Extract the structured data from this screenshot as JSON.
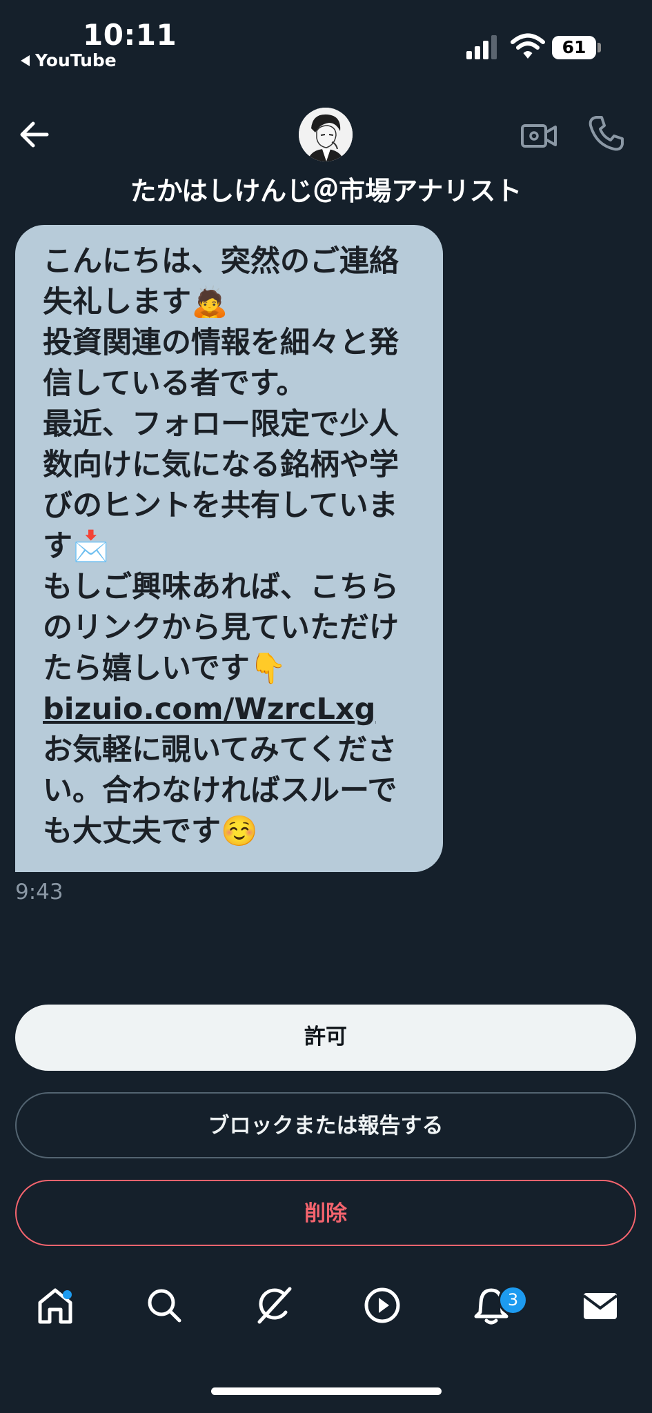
{
  "status_bar": {
    "time": "10:11",
    "back_app": "YouTube",
    "battery": "61"
  },
  "header": {
    "contact_name": "たかはしけんじ＠市場アナリスト",
    "back_icon": "arrow-left-icon",
    "video_icon": "video-camera-icon",
    "phone_icon": "phone-icon"
  },
  "message": {
    "text_before_link": "こんにちは、突然のご連絡失礼します🙇\n投資関連の情報を細々と発信している者です。\n最近、フォロー限定で少人数向けに気になる銘柄や学びのヒントを共有しています📩\nもしご興味あれば、こちらのリンクから見ていただけたら嬉しいです👇\n",
    "link": "bizuio.com/WzrcLxg",
    "text_after_link": "\nお気軽に覗いてみてください。合わなければスルーでも大丈夫です☺️",
    "time": "9:43"
  },
  "actions": {
    "allow": "許可",
    "block_report": "ブロックまたは報告する",
    "delete": "削除"
  },
  "tabbar": {
    "items": [
      "home-icon",
      "search-icon",
      "grok-icon",
      "play-icon",
      "bell-icon",
      "mail-icon"
    ],
    "notifications_badge": "3"
  },
  "colors": {
    "background": "#15202b",
    "bubble": "#b7cbd9",
    "accent": "#1d9bf0",
    "danger": "#f4646e"
  }
}
